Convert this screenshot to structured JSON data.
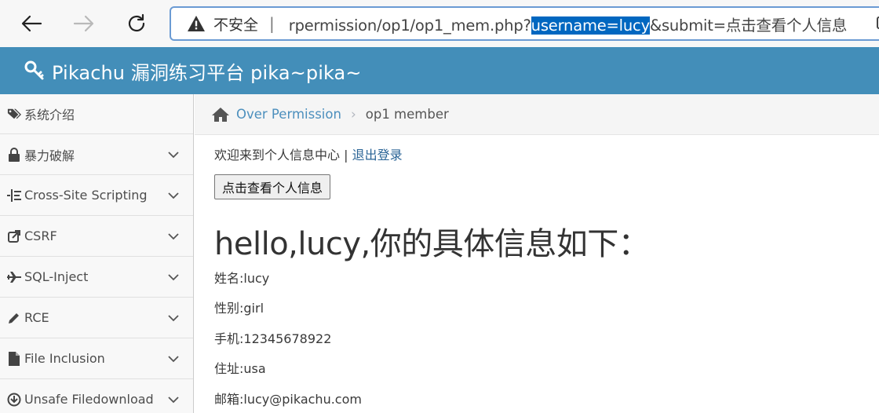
{
  "browser": {
    "insecure_label": "不安全",
    "separator": "|",
    "url_prefix": "rpermission/op1/op1_mem.php?",
    "url_highlight": "username=lucy",
    "url_suffix": "&submit=点击查看个人信息"
  },
  "header": {
    "title": "Pikachu 漏洞练习平台 pika~pika~"
  },
  "sidebar": {
    "items": [
      {
        "label": "系统介绍",
        "icon": "tags-icon"
      },
      {
        "label": "暴力破解",
        "icon": "lock-icon"
      },
      {
        "label": "Cross-Site Scripting",
        "icon": "list-icon"
      },
      {
        "label": "CSRF",
        "icon": "share-icon"
      },
      {
        "label": "SQL-Inject",
        "icon": "plane-icon"
      },
      {
        "label": "RCE",
        "icon": "pencil-icon"
      },
      {
        "label": "File Inclusion",
        "icon": "file-icon"
      },
      {
        "label": "Unsafe Filedownload",
        "icon": "download-icon"
      }
    ]
  },
  "breadcrumb": {
    "link": "Over Permission",
    "separator": "›",
    "current": "op1 member"
  },
  "main": {
    "welcome": "欢迎来到个人信息中心 | ",
    "logout": "退出登录",
    "button": "点击查看个人信息",
    "heading": "hello,lucy,你的具体信息如下：",
    "rows": {
      "name": "姓名:lucy",
      "sex": "性别:girl",
      "phone": "手机:12345678922",
      "addr": "住址:usa",
      "email": "邮箱:lucy@pikachu.com"
    }
  },
  "colors": {
    "header_bg": "#438eb9",
    "link": "#4c8fbd",
    "url_highlight": "#0067c0"
  }
}
